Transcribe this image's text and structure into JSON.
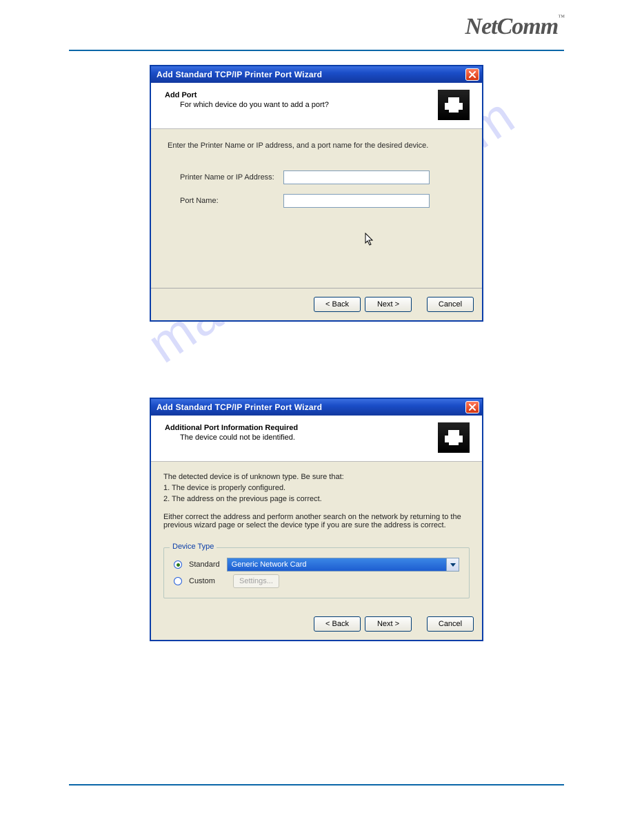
{
  "brand": {
    "name": "NetComm",
    "tm": "™"
  },
  "watermark": "manualshive.com",
  "dialog1": {
    "title": "Add Standard TCP/IP Printer Port Wizard",
    "head_title": "Add Port",
    "head_sub": "For which device do you want to add a port?",
    "instruction": "Enter the Printer Name or IP address, and a port name for the desired device.",
    "printer_label": "Printer Name or IP Address:",
    "printer_value": "",
    "port_label": "Port Name:",
    "port_value": "",
    "btn_back": "< Back",
    "btn_next": "Next >",
    "btn_cancel": "Cancel"
  },
  "dialog2": {
    "title": "Add Standard TCP/IP Printer Port Wizard",
    "head_title": "Additional Port Information Required",
    "head_sub": "The device could not be identified.",
    "p1": "The detected device is of unknown type.  Be sure that:",
    "p2": "1. The device is properly configured.",
    "p3": "2.  The address on the previous page is correct.",
    "p4": "Either correct the address and perform another search on the network by returning to the previous wizard page or select the device type if you are sure the address is correct.",
    "group_label": "Device Type",
    "radio_standard": "Standard",
    "radio_custom": "Custom",
    "combo_value": "Generic Network Card",
    "btn_settings": "Settings...",
    "btn_back": "< Back",
    "btn_next": "Next >",
    "btn_cancel": "Cancel"
  }
}
